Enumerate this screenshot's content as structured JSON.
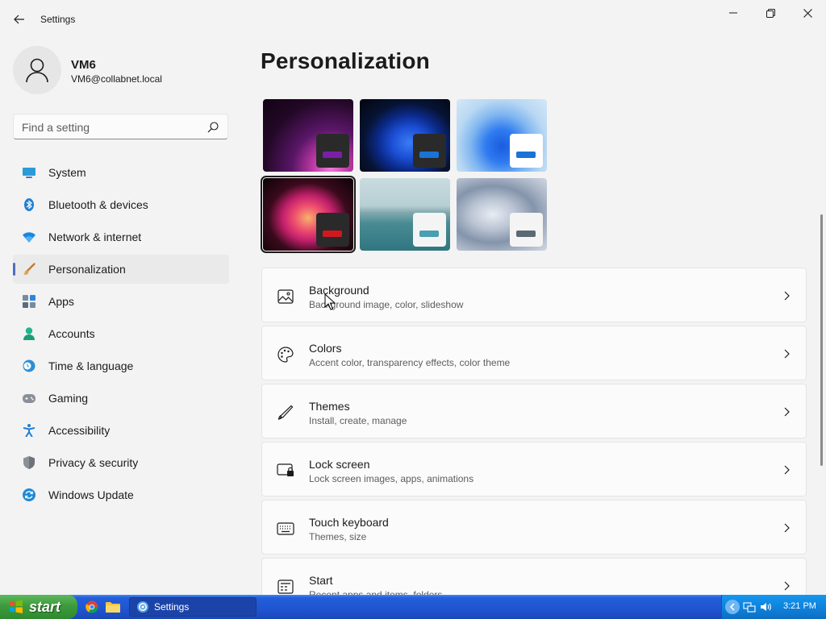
{
  "app": {
    "title": "Settings"
  },
  "profile": {
    "name": "VM6",
    "email": "VM6@collabnet.local"
  },
  "search": {
    "placeholder": "Find a setting"
  },
  "sidebar": {
    "items": [
      {
        "label": "System",
        "icon": "monitor-icon"
      },
      {
        "label": "Bluetooth & devices",
        "icon": "bluetooth-icon"
      },
      {
        "label": "Network & internet",
        "icon": "wifi-icon"
      },
      {
        "label": "Personalization",
        "icon": "paintbrush-icon",
        "active": true
      },
      {
        "label": "Apps",
        "icon": "apps-icon"
      },
      {
        "label": "Accounts",
        "icon": "accounts-icon"
      },
      {
        "label": "Time & language",
        "icon": "clock-globe-icon"
      },
      {
        "label": "Gaming",
        "icon": "gamepad-icon"
      },
      {
        "label": "Accessibility",
        "icon": "accessibility-icon"
      },
      {
        "label": "Privacy & security",
        "icon": "shield-icon"
      },
      {
        "label": "Windows Update",
        "icon": "update-icon"
      }
    ]
  },
  "main": {
    "title": "Personalization",
    "themes": [
      {
        "name": "theme-glow",
        "accent": "#7a1fa8",
        "swatch": "#2a2a2a"
      },
      {
        "name": "theme-bloom-dark",
        "accent": "#1a73d6",
        "swatch": "#2a2a2a"
      },
      {
        "name": "theme-bloom-light",
        "accent": "#1a73d6",
        "swatch": "#ffffff"
      },
      {
        "name": "theme-captured-motion",
        "accent": "#d01820",
        "swatch": "#2a2a2a",
        "selected": true
      },
      {
        "name": "theme-sunrise",
        "accent": "#4a9fb0",
        "swatch": "#f4f4f4"
      },
      {
        "name": "theme-flow",
        "accent": "#5a6a72",
        "swatch": "#f4f4f4"
      }
    ],
    "cards": [
      {
        "title": "Background",
        "desc": "Background image, color, slideshow",
        "icon": "image-icon"
      },
      {
        "title": "Colors",
        "desc": "Accent color, transparency effects, color theme",
        "icon": "palette-icon"
      },
      {
        "title": "Themes",
        "desc": "Install, create, manage",
        "icon": "pen-icon"
      },
      {
        "title": "Lock screen",
        "desc": "Lock screen images, apps, animations",
        "icon": "lock-screen-icon"
      },
      {
        "title": "Touch keyboard",
        "desc": "Themes, size",
        "icon": "keyboard-icon"
      },
      {
        "title": "Start",
        "desc": "Recent apps and items, folders",
        "icon": "start-icon"
      }
    ]
  },
  "taskbar": {
    "start_label": "start",
    "task_label": "Settings",
    "clock": "3:21 PM"
  },
  "colors": {
    "accent": "#4c6fbf",
    "taskbar": "#245edb",
    "start": "#3c9b3c"
  }
}
